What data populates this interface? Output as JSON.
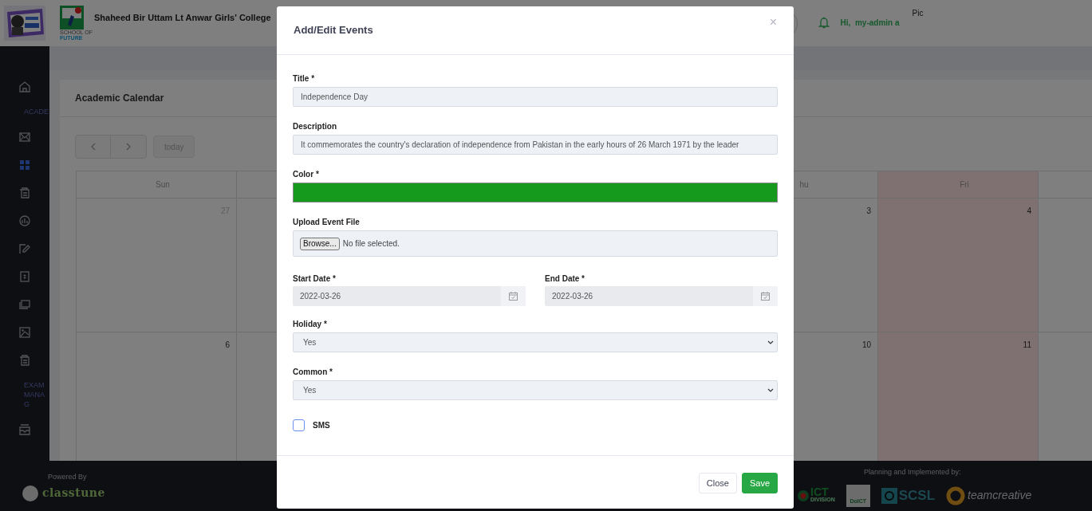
{
  "header": {
    "school_name": "Shaheed Bir Uttam Lt Anwar Girls' College",
    "logo_caption": [
      "SCHOOL OF",
      "FUTURE"
    ],
    "greeting": "Hi,  my-admin a",
    "profile_pic": "Pic"
  },
  "sidebar": {
    "items": [
      {
        "kind": "icon",
        "selected": false
      },
      {
        "kind": "section",
        "label": "ACADE"
      },
      {
        "kind": "icon",
        "selected": false
      },
      {
        "kind": "icon",
        "selected": true
      },
      {
        "kind": "icon",
        "selected": false
      },
      {
        "kind": "icon",
        "selected": false
      },
      {
        "kind": "icon",
        "selected": false
      },
      {
        "kind": "icon",
        "selected": false
      },
      {
        "kind": "icon",
        "selected": false
      },
      {
        "kind": "icon",
        "selected": false
      },
      {
        "kind": "icon",
        "selected": false
      },
      {
        "kind": "section",
        "label": "EXAM MANAG"
      },
      {
        "kind": "icon",
        "selected": false
      }
    ]
  },
  "content": {
    "card_title": "Academic Calendar",
    "today_button": "today",
    "calendar": {
      "columns": [
        {
          "kind": "sun",
          "label": "Sun",
          "holiday": false
        },
        {
          "kind": "thu",
          "label": "hu",
          "holiday": false
        },
        {
          "kind": "fri",
          "label": "Fri",
          "holiday": true
        }
      ],
      "weeks": [
        {
          "days": [
            {
              "kind": "sun",
              "date": "27",
              "other_month": true
            },
            {
              "kind": "thu",
              "date": "3",
              "other_month": false
            },
            {
              "kind": "fri",
              "date": "4",
              "other_month": false
            }
          ]
        },
        {
          "days": [
            {
              "kind": "sun",
              "date": "6",
              "other_month": false
            },
            {
              "kind": "thu",
              "date": "10",
              "other_month": false
            },
            {
              "kind": "fri",
              "date": "11",
              "other_month": false
            }
          ]
        }
      ]
    }
  },
  "footer": {
    "powered_by": "Powered By",
    "brand": "classtune",
    "planning": "Planning and Implemented by:",
    "partners": [
      {
        "kind": "ict",
        "text": "ICT",
        "sub": "DIVISION"
      },
      {
        "kind": "doict",
        "text": "DoICT"
      },
      {
        "kind": "scsl",
        "text": "SCSL"
      },
      {
        "kind": "team",
        "text": "teamcreative"
      }
    ]
  },
  "modal": {
    "title": "Add/Edit Events",
    "close": "×",
    "fields": [
      {
        "kind": "text",
        "label": "Title *",
        "value": "Independence Day"
      },
      {
        "kind": "text",
        "label": "Description",
        "value": "It commemorates the country's declaration of independence from Pakistan in the early hours of 26 March 1971 by the leader"
      },
      {
        "kind": "color",
        "label": "Color *",
        "color": "#159a1d"
      },
      {
        "kind": "file",
        "label": "Upload Event File",
        "button": "Browse...",
        "status": "No file selected."
      },
      {
        "kind": "dates",
        "items": [
          {
            "label": "Start Date *",
            "value": "2022-03-26"
          },
          {
            "label": "End Date *",
            "value": "2022-03-26"
          }
        ]
      },
      {
        "kind": "select",
        "label": "Holiday *",
        "value": "Yes"
      },
      {
        "kind": "select",
        "label": "Common *",
        "value": "Yes"
      },
      {
        "kind": "checkbox",
        "label": "SMS",
        "checked": false
      }
    ],
    "buttons": [
      {
        "kind": "secondary",
        "label": "Close"
      },
      {
        "kind": "primary",
        "label": "Save"
      }
    ]
  }
}
